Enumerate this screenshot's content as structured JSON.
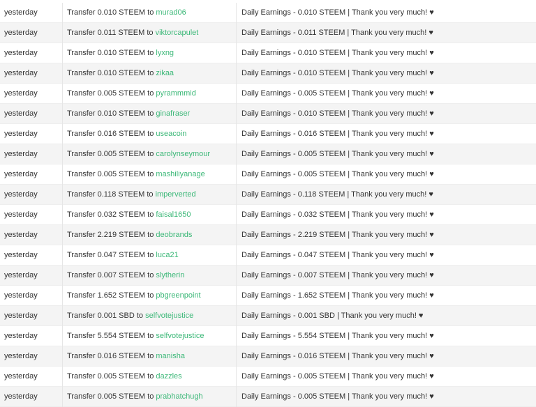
{
  "transfers": [
    {
      "date": "yesterday",
      "prefix": "Transfer 0.010 STEEM to ",
      "user": "murad06",
      "memo": "Daily Earnings - 0.010 STEEM | Thank you very much! ♥"
    },
    {
      "date": "yesterday",
      "prefix": "Transfer 0.011 STEEM to ",
      "user": "viktorcapulet",
      "memo": "Daily Earnings - 0.011 STEEM | Thank you very much! ♥"
    },
    {
      "date": "yesterday",
      "prefix": "Transfer 0.010 STEEM to ",
      "user": "lyxng",
      "memo": "Daily Earnings - 0.010 STEEM | Thank you very much! ♥"
    },
    {
      "date": "yesterday",
      "prefix": "Transfer 0.010 STEEM to ",
      "user": "zikaa",
      "memo": "Daily Earnings - 0.010 STEEM | Thank you very much! ♥"
    },
    {
      "date": "yesterday",
      "prefix": "Transfer 0.005 STEEM to ",
      "user": "pyrammmid",
      "memo": "Daily Earnings - 0.005 STEEM | Thank you very much! ♥"
    },
    {
      "date": "yesterday",
      "prefix": "Transfer 0.010 STEEM to ",
      "user": "ginafraser",
      "memo": "Daily Earnings - 0.010 STEEM | Thank you very much! ♥"
    },
    {
      "date": "yesterday",
      "prefix": "Transfer 0.016 STEEM to ",
      "user": "useacoin",
      "memo": "Daily Earnings - 0.016 STEEM | Thank you very much! ♥"
    },
    {
      "date": "yesterday",
      "prefix": "Transfer 0.005 STEEM to ",
      "user": "carolynseymour",
      "memo": "Daily Earnings - 0.005 STEEM | Thank you very much! ♥"
    },
    {
      "date": "yesterday",
      "prefix": "Transfer 0.005 STEEM to ",
      "user": "mashiliyanage",
      "memo": "Daily Earnings - 0.005 STEEM | Thank you very much! ♥"
    },
    {
      "date": "yesterday",
      "prefix": "Transfer 0.118 STEEM to ",
      "user": "imperverted",
      "memo": "Daily Earnings - 0.118 STEEM | Thank you very much! ♥"
    },
    {
      "date": "yesterday",
      "prefix": "Transfer 0.032 STEEM to ",
      "user": "faisal1650",
      "memo": "Daily Earnings - 0.032 STEEM | Thank you very much! ♥"
    },
    {
      "date": "yesterday",
      "prefix": "Transfer 2.219 STEEM to ",
      "user": "deobrands",
      "memo": "Daily Earnings - 2.219 STEEM | Thank you very much! ♥"
    },
    {
      "date": "yesterday",
      "prefix": "Transfer 0.047 STEEM to ",
      "user": "luca21",
      "memo": "Daily Earnings - 0.047 STEEM | Thank you very much! ♥"
    },
    {
      "date": "yesterday",
      "prefix": "Transfer 0.007 STEEM to ",
      "user": "slytherin",
      "memo": "Daily Earnings - 0.007 STEEM | Thank you very much! ♥"
    },
    {
      "date": "yesterday",
      "prefix": "Transfer 1.652 STEEM to ",
      "user": "pbgreenpoint",
      "memo": "Daily Earnings - 1.652 STEEM | Thank you very much! ♥"
    },
    {
      "date": "yesterday",
      "prefix": "Transfer 0.001 SBD to ",
      "user": "selfvotejustice",
      "memo": "Daily Earnings - 0.001 SBD | Thank you very much! ♥"
    },
    {
      "date": "yesterday",
      "prefix": "Transfer 5.554 STEEM to ",
      "user": "selfvotejustice",
      "memo": "Daily Earnings - 5.554 STEEM | Thank you very much! ♥"
    },
    {
      "date": "yesterday",
      "prefix": "Transfer 0.016 STEEM to ",
      "user": "manisha",
      "memo": "Daily Earnings - 0.016 STEEM | Thank you very much! ♥"
    },
    {
      "date": "yesterday",
      "prefix": "Transfer 0.005 STEEM to ",
      "user": "dazzles",
      "memo": "Daily Earnings - 0.005 STEEM | Thank you very much! ♥"
    },
    {
      "date": "yesterday",
      "prefix": "Transfer 0.005 STEEM to ",
      "user": "prabhatchugh",
      "memo": "Daily Earnings - 0.005 STEEM | Thank you very much! ♥"
    }
  ]
}
